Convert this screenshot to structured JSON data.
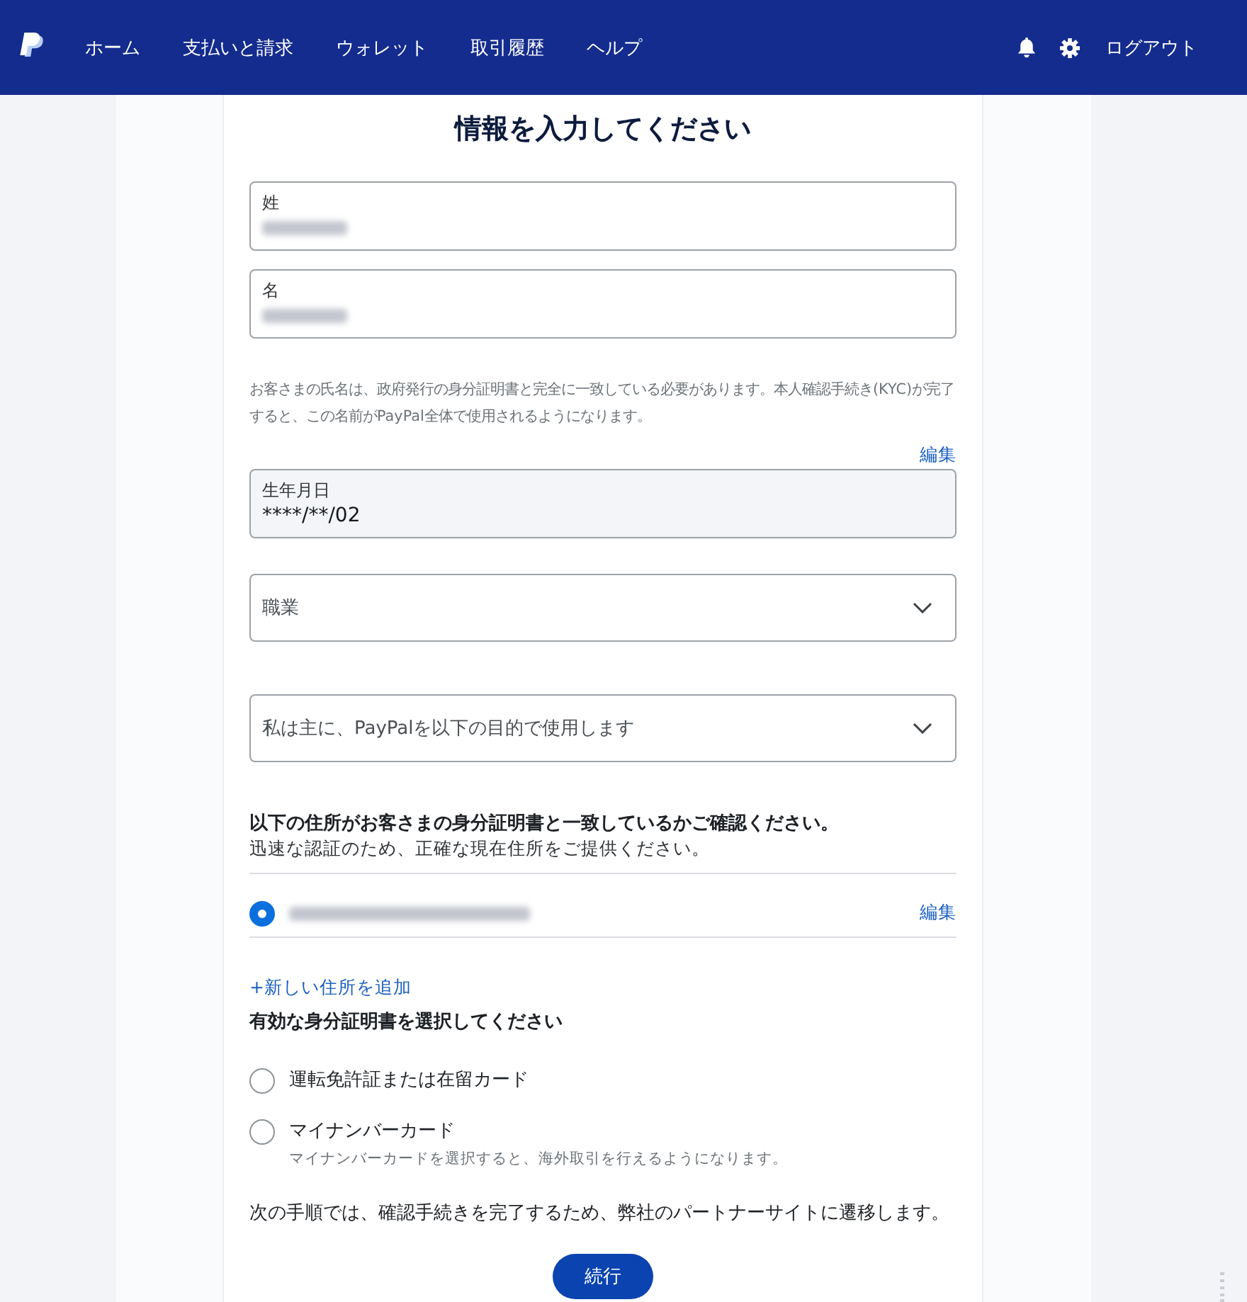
{
  "header": {
    "nav": [
      {
        "label": "ホーム"
      },
      {
        "label": "支払いと請求"
      },
      {
        "label": "ウォレット"
      },
      {
        "label": "取引履歴"
      },
      {
        "label": "ヘルプ"
      }
    ],
    "logout": "ログアウト"
  },
  "form": {
    "title": "情報を入力してください",
    "name_fields": [
      {
        "label": "姓",
        "value_blurred": true
      },
      {
        "label": "名",
        "value_blurred": true
      }
    ],
    "name_note": "お客さまの氏名は、政府発行の身分証明書と完全に一致している必要があります。本人確認手続き(KYC)が完了すると、この名前がPayPal全体で使用されるようになります。",
    "birthdate": {
      "edit_link": "編集",
      "label": "生年月日",
      "value": "****/**/02",
      "disabled": true
    },
    "selects": [
      {
        "placeholder": "職業"
      },
      {
        "placeholder": "私は主に、PayPalを以下の目的で使用します"
      }
    ],
    "address": {
      "heading": "以下の住所がお客さまの身分証明書と一致しているかご確認ください。",
      "subheading": "迅速な認証のため、正確な現在住所をご提供ください。",
      "items": [
        {
          "selected": true,
          "value_blurred": true,
          "edit_link": "編集"
        }
      ],
      "add_link": "+新しい住所を追加"
    },
    "id_document": {
      "heading": "有効な身分証明書を選択してください",
      "options": [
        {
          "label": "運転免許証または在留カード",
          "selected": false
        },
        {
          "label": "マイナンバーカード",
          "description": "マイナンバーカードを選択すると、海外取引を行えるようになります。",
          "selected": false
        }
      ]
    },
    "next_note": "次の手順では、確認手続きを完了するため、弊社のパートナーサイトに遷移します。",
    "continue_button": "続行"
  }
}
